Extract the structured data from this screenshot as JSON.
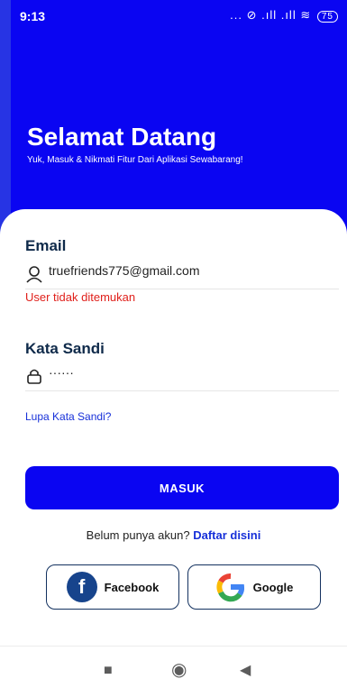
{
  "status_bar": {
    "time": "9:13",
    "signal": "... ⊘ .ıll .ıll",
    "battery": "75"
  },
  "hero": {
    "title": "Selamat Datang",
    "subtitle": "Yuk, Masuk & Nikmati Fitur Dari Aplikasi Sewabarang!"
  },
  "form": {
    "email_label": "Email",
    "email_value": "truefriends775@gmail.com",
    "email_error": "User tidak ditemukan",
    "password_label": "Kata Sandi",
    "password_value": "······",
    "forgot_link": "Lupa Kata Sandi?",
    "submit_label": "MASUK"
  },
  "signup": {
    "prompt": "Belum punya akun?",
    "link": "Daftar disini"
  },
  "social": {
    "facebook_label": "Facebook",
    "google_label": "Google"
  },
  "colors": {
    "primary": "#0a05f2",
    "error": "#e0201b",
    "link": "#1730d9",
    "label": "#0f2a4a"
  }
}
